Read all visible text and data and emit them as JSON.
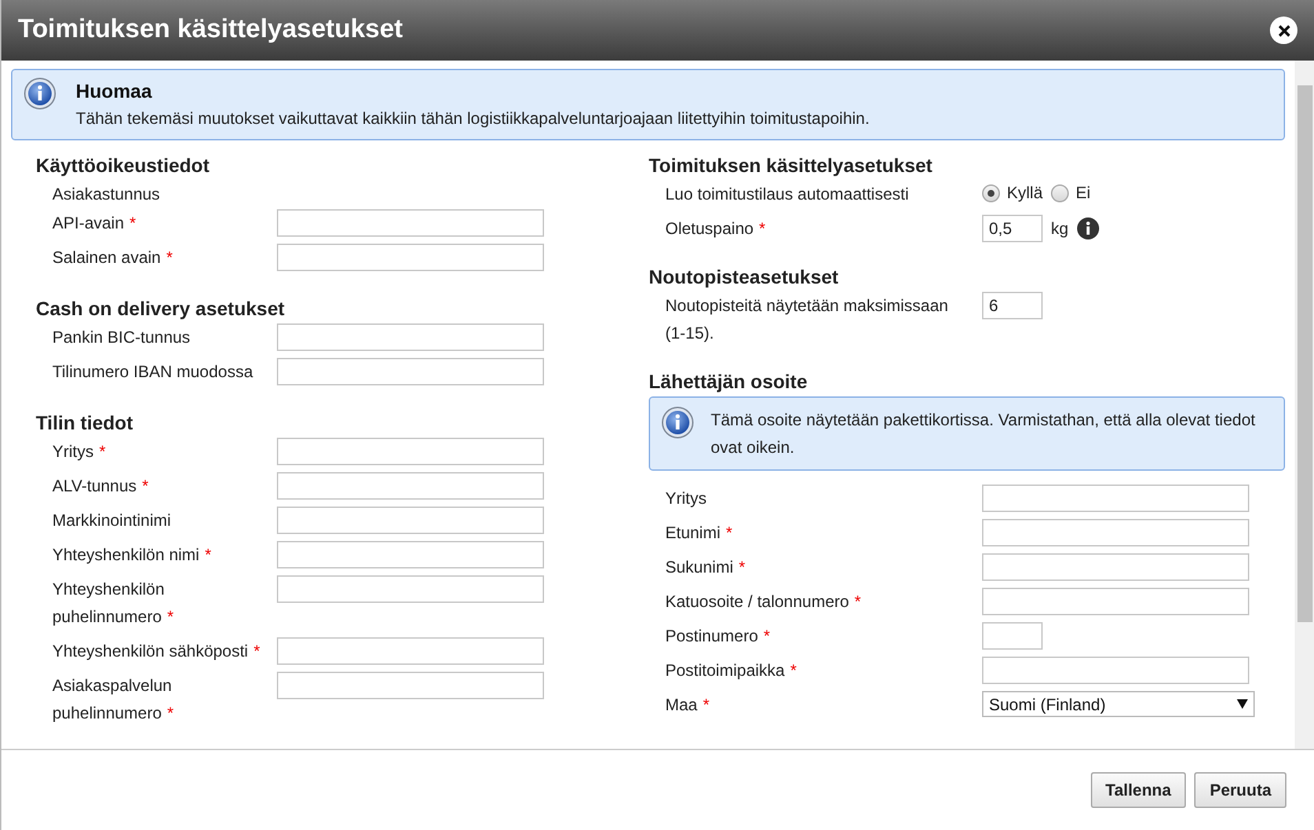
{
  "dialog": {
    "title": "Toimituksen käsittelyasetukset"
  },
  "notice": {
    "title": "Huomaa",
    "text": "Tähän tekemäsi muutokset vaikuttavat kaikkiin tähän logistiikkapalveluntarjoajaan liitettyihin toimitustapoihin."
  },
  "left_sections": [
    {
      "heading": "Käyttöoikeustiedot",
      "fields": [
        {
          "kind": "label_only",
          "label": "Asiakastunnus"
        },
        {
          "kind": "text",
          "label": "API-avain",
          "required_mark": "*"
        },
        {
          "kind": "text",
          "label": "Salainen avain",
          "required_mark": "*"
        }
      ]
    },
    {
      "heading": "Cash on delivery asetukset",
      "fields": [
        {
          "kind": "text",
          "label": "Pankin BIC-tunnus"
        },
        {
          "kind": "text",
          "label": "Tilinumero IBAN muodossa"
        }
      ]
    },
    {
      "heading": "Tilin tiedot",
      "fields": [
        {
          "kind": "text",
          "label": "Yritys",
          "required_mark": "*"
        },
        {
          "kind": "text",
          "label": "ALV-tunnus",
          "required_mark": "*"
        },
        {
          "kind": "text",
          "label": "Markkinointinimi"
        },
        {
          "kind": "text",
          "label": "Yhteyshenkilön nimi",
          "required_mark": "*"
        },
        {
          "kind": "text",
          "label": "Yhteyshenkilön puhelinnumero",
          "required_mark": "*"
        },
        {
          "kind": "text",
          "label": "Yhteyshenkilön sähköposti",
          "required_mark": "*"
        },
        {
          "kind": "text",
          "label": "Asiakaspalvelun puhelinnumero",
          "required_mark": "*"
        }
      ]
    }
  ],
  "right_sections": [
    {
      "heading": "Toimituksen käsittelyasetukset",
      "fields": [
        {
          "kind": "radio",
          "label": "Luo toimitustilaus automaattisesti",
          "options": [
            {
              "label": "Kyllä",
              "selected": true
            },
            {
              "label": "Ei",
              "selected": false
            }
          ]
        },
        {
          "kind": "short",
          "label": "Oletuspaino",
          "required_mark": "*",
          "value": "0,5",
          "unit": "kg",
          "info": true
        }
      ]
    },
    {
      "heading": "Noutopisteasetukset",
      "fields": [
        {
          "kind": "short",
          "label": "Noutopisteitä näytetään maksimissaan (1-15).",
          "value": "6"
        }
      ]
    },
    {
      "heading": "Lähettäjän osoite",
      "notice": "Tämä osoite näytetään pakettikortissa. Varmistathan, että alla olevat tiedot ovat oikein.",
      "fields": [
        {
          "kind": "text",
          "label": "Yritys"
        },
        {
          "kind": "text",
          "label": "Etunimi",
          "required_mark": "*"
        },
        {
          "kind": "text",
          "label": "Sukunimi",
          "required_mark": "*"
        },
        {
          "kind": "text",
          "label": "Katuosoite / talonnumero",
          "required_mark": "*"
        },
        {
          "kind": "short",
          "label": "Postinumero",
          "required_mark": "*"
        },
        {
          "kind": "text",
          "label": "Postitoimipaikka",
          "required_mark": "*"
        },
        {
          "kind": "select",
          "label": "Maa",
          "required_mark": "*",
          "value": "Suomi (Finland)"
        }
      ]
    }
  ],
  "buttons": [
    "Tallenna",
    "Peruuta"
  ]
}
